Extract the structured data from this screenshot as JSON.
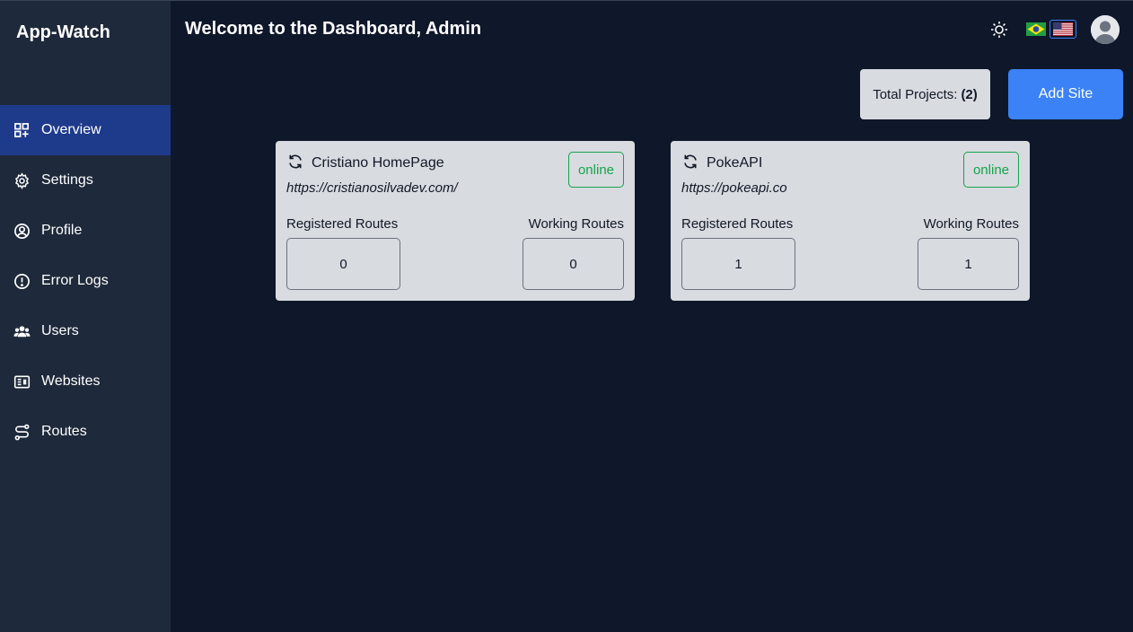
{
  "app": {
    "title": "App-Watch"
  },
  "sidebar": {
    "items": [
      {
        "label": "Overview",
        "icon": "grid-plus-icon",
        "active": true
      },
      {
        "label": "Settings",
        "icon": "gear-icon"
      },
      {
        "label": "Profile",
        "icon": "user-circle-icon"
      },
      {
        "label": "Error Logs",
        "icon": "alert-circle-icon"
      },
      {
        "label": "Users",
        "icon": "users-icon"
      },
      {
        "label": "Websites",
        "icon": "newspaper-icon"
      },
      {
        "label": "Routes",
        "icon": "route-icon"
      }
    ]
  },
  "header": {
    "title": "Welcome to the Dashboard, Admin",
    "theme_icon": "sun-icon",
    "languages": [
      "pt-BR flag",
      "en-US flag"
    ]
  },
  "summary": {
    "total_label": "Total Projects:",
    "total_value": "(2)",
    "add_button": "Add Site"
  },
  "projects": [
    {
      "name": "Cristiano HomePage",
      "url": "https://cristianosilvadev.com/",
      "status": "online",
      "registered_label": "Registered Routes",
      "registered_value": "0",
      "working_label": "Working Routes",
      "working_value": "0"
    },
    {
      "name": "PokeAPI",
      "url": "https://pokeapi.co",
      "status": "online",
      "registered_label": "Registered Routes",
      "registered_value": "1",
      "working_label": "Working Routes",
      "working_value": "1"
    }
  ],
  "colors": {
    "background": "#0f172a",
    "sidebar": "#1e293b",
    "active_nav": "#1e3a8a",
    "accent": "#3b82f6",
    "card": "#d8dbe0",
    "online": "#16a34a"
  }
}
